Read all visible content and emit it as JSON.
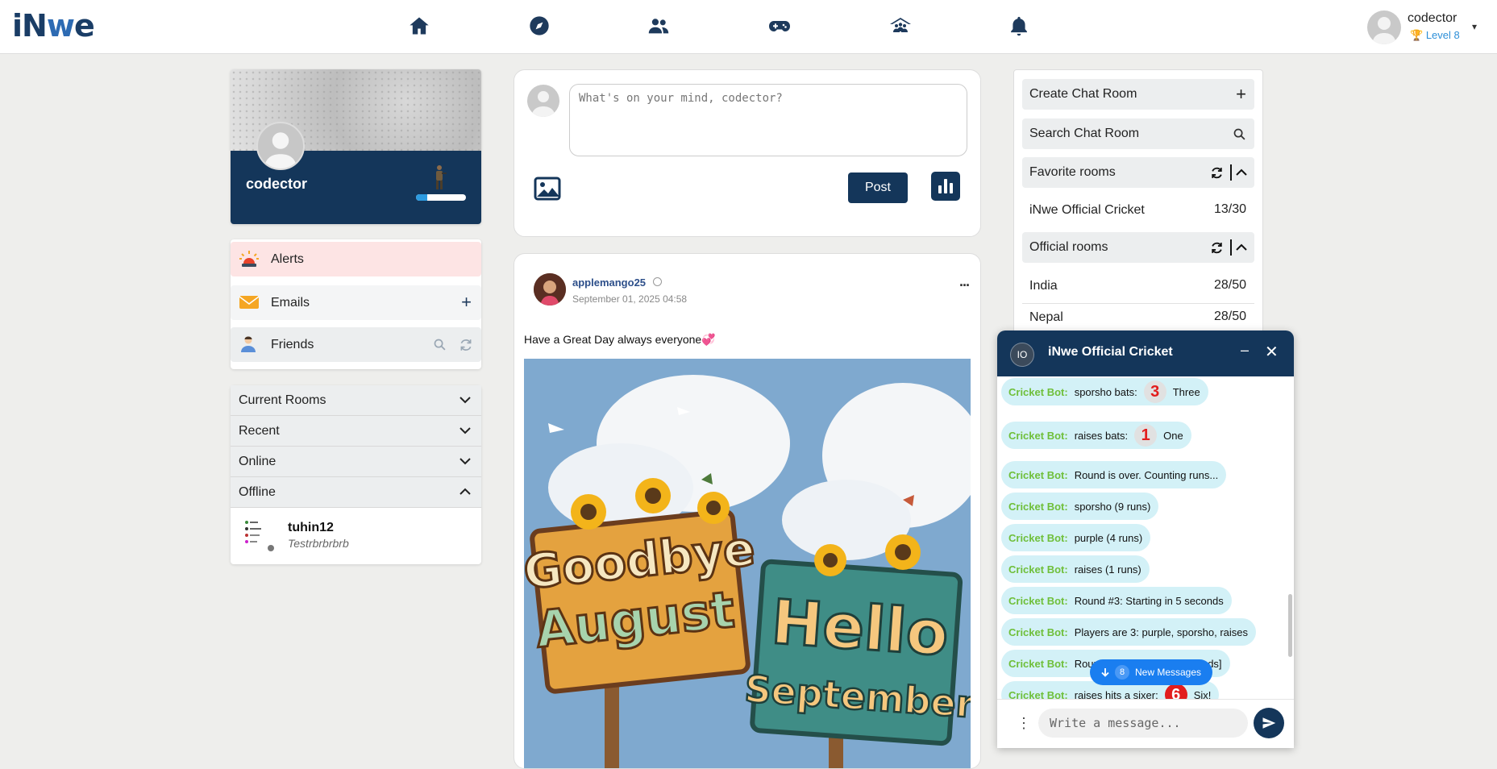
{
  "app": {
    "logo_text_pre": "iN",
    "logo_text_w": "w",
    "logo_text_post": "e"
  },
  "topnav": {
    "icons": [
      "home-icon",
      "compass-icon",
      "users-icon",
      "gamepad-icon",
      "community-icon",
      "bell-icon"
    ]
  },
  "user": {
    "name": "codector",
    "level": "Level 8",
    "caret": "▾"
  },
  "profile": {
    "name": "codector",
    "xp_fraction": 0.22
  },
  "side_menu": {
    "alerts": "Alerts",
    "emails": "Emails",
    "emails_action": "+",
    "friends": "Friends"
  },
  "accordion": {
    "current_rooms": "Current Rooms",
    "recent": "Recent",
    "online": "Online",
    "offline": "Offline",
    "offline_user": {
      "name": "tuhin12",
      "status": "Testrbrbrbrb"
    }
  },
  "composer": {
    "placeholder": "What's on your mind, codector?",
    "post_label": "Post"
  },
  "post": {
    "author": "applemango25",
    "date": "September 01, 2025 04:58",
    "more": "...",
    "text": "Have a Great Day always everyone💞",
    "image": {
      "sign_left_line1": "Goodbye",
      "sign_left_line2": "August",
      "sign_right_line1": "Hello",
      "sign_right_line2": "September"
    }
  },
  "rooms": {
    "create_label": "Create Chat Room",
    "create_action": "+",
    "search_label": "Search Chat Room",
    "favorite_label": "Favorite rooms",
    "favorite_items": [
      {
        "name": "iNwe Official Cricket",
        "count": "13/30"
      }
    ],
    "official_label": "Official rooms",
    "official_items": [
      {
        "name": "India",
        "count": "28/50"
      },
      {
        "name": "Nepal",
        "count": "28/50"
      }
    ]
  },
  "chat": {
    "badge": "IO",
    "title": "iNwe Official Cricket",
    "minimize": "–",
    "close": "✕",
    "bot_label": "Cricket Bot:",
    "messages": [
      {
        "text": "sporsho bats:",
        "num": "3",
        "after": "Three"
      },
      {
        "text": "raises bats:",
        "num": "1",
        "after": "One"
      },
      {
        "text": "Round is over. Counting runs..."
      },
      {
        "text": "sporsho (9 runs)"
      },
      {
        "text": "purple (4 runs)"
      },
      {
        "text": "raises (1 runs)"
      },
      {
        "text": "Round #3: Starting in 5 seconds"
      },
      {
        "text": "Players are 3: purple, sporsho, raises"
      },
      {
        "text": "Round #3: Started [20 seconds]"
      },
      {
        "text": "raises hits a sixer:",
        "num": "6",
        "after": "Six!"
      }
    ],
    "new_messages_count": "8",
    "new_messages_label": "New Messages",
    "input_placeholder": "Write a message...",
    "dots": "⋮"
  },
  "colors": {
    "navy": "#14365a",
    "accent_blue": "#1a7ef0",
    "bot_green": "#6fbf3a",
    "bubble": "#d3f1f7",
    "alerts_bg": "#fde4e4"
  }
}
